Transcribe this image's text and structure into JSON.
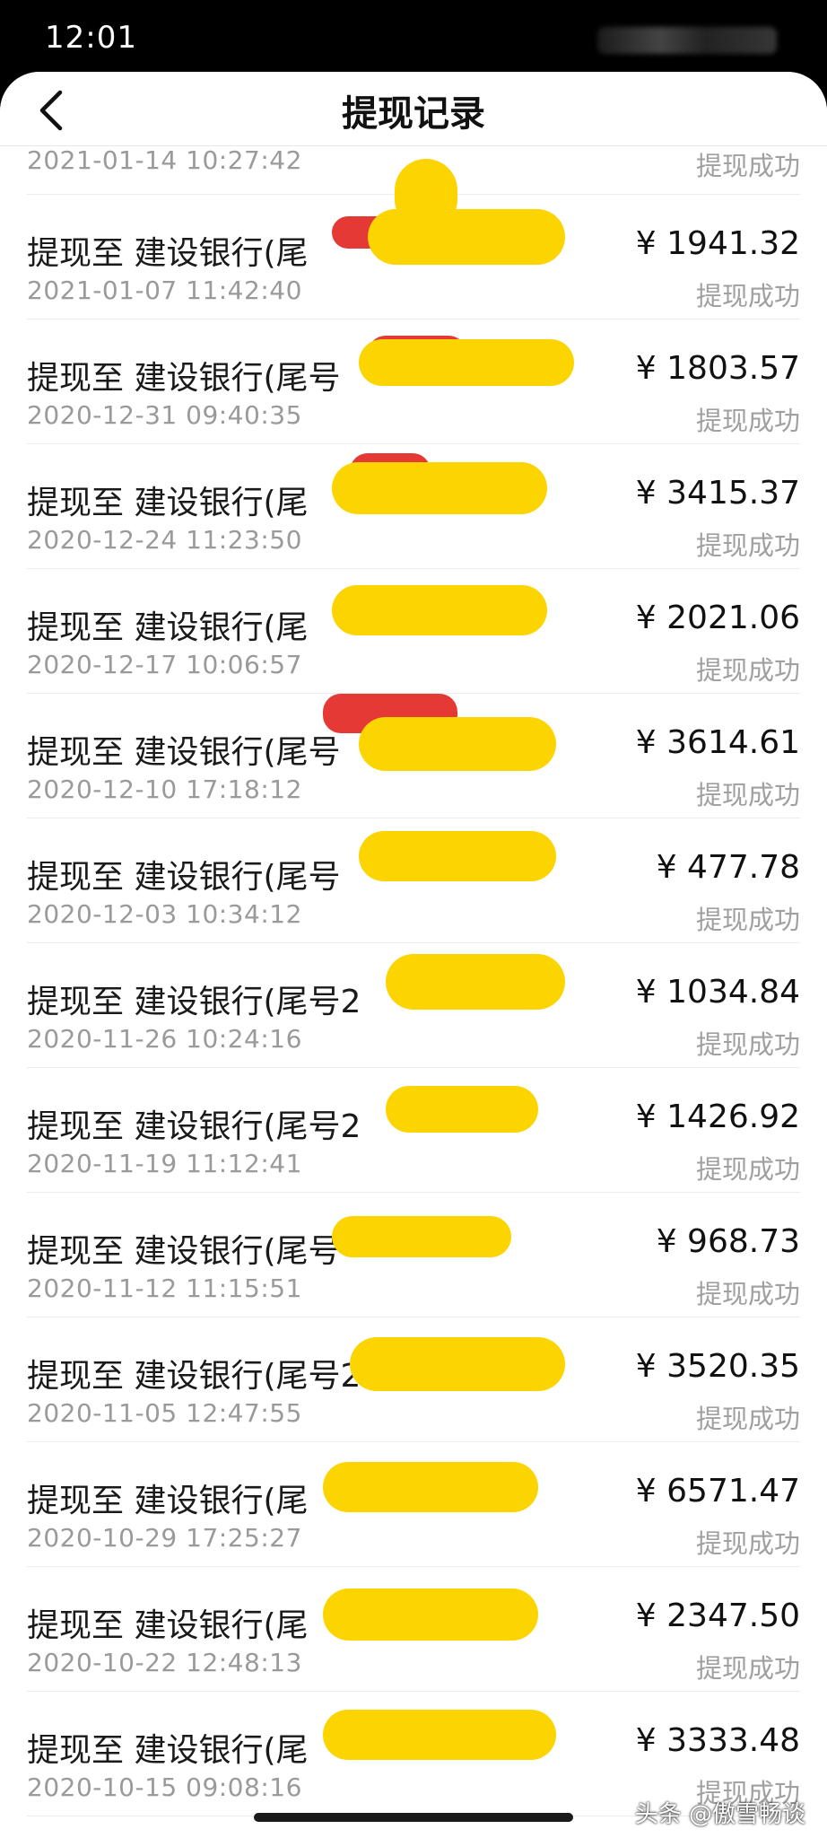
{
  "status": {
    "time": "12:01"
  },
  "header": {
    "title": "提现记录",
    "back_icon": "chevron-left-icon"
  },
  "first_row": {
    "date": "2021-01-14 10:27:42",
    "status": "提现成功"
  },
  "records": [
    {
      "title": "提现至 建设银行(尾",
      "amount": "¥ 1941.32",
      "date": "2021-01-07 11:42:40",
      "status": "提现成功"
    },
    {
      "title": "提现至 建设银行(尾号",
      "amount": "¥ 1803.57",
      "date": "2020-12-31 09:40:35",
      "status": "提现成功"
    },
    {
      "title": "提现至 建设银行(尾",
      "amount": "¥ 3415.37",
      "date": "2020-12-24 11:23:50",
      "status": "提现成功"
    },
    {
      "title": "提现至 建设银行(尾",
      "amount": "¥ 2021.06",
      "date": "2020-12-17 10:06:57",
      "status": "提现成功"
    },
    {
      "title": "提现至 建设银行(尾号",
      "amount": "¥ 3614.61",
      "date": "2020-12-10 17:18:12",
      "status": "提现成功"
    },
    {
      "title": "提现至 建设银行(尾号",
      "amount": "¥ 477.78",
      "date": "2020-12-03 10:34:12",
      "status": "提现成功"
    },
    {
      "title": "提现至 建设银行(尾号2",
      "amount": "¥ 1034.84",
      "date": "2020-11-26 10:24:16",
      "status": "提现成功"
    },
    {
      "title": "提现至 建设银行(尾号2",
      "amount": "¥ 1426.92",
      "date": "2020-11-19 11:12:41",
      "status": "提现成功"
    },
    {
      "title": "提现至 建设银行(尾号",
      "amount": "¥ 968.73",
      "date": "2020-11-12 11:15:51",
      "status": "提现成功"
    },
    {
      "title": "提现至 建设银行(尾号2",
      "amount": "¥ 3520.35",
      "date": "2020-11-05 12:47:55",
      "status": "提现成功"
    },
    {
      "title": "提现至 建设银行(尾",
      "amount": "¥ 6571.47",
      "date": "2020-10-29 17:25:27",
      "status": "提现成功"
    },
    {
      "title": "提现至 建设银行(尾",
      "amount": "¥ 2347.50",
      "date": "2020-10-22 12:48:13",
      "status": "提现成功"
    },
    {
      "title": "提现至 建设银行(尾",
      "amount": "¥ 3333.48",
      "date": "2020-10-15 09:08:16",
      "status": "提现成功"
    }
  ],
  "watermark": "头条 @傲雪畅谈",
  "colors": {
    "redact_yellow": "#fcd400",
    "redact_red": "#e53935"
  }
}
